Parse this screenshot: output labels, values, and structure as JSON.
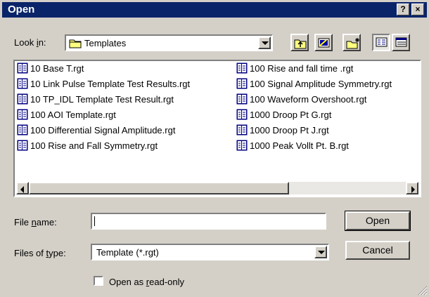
{
  "window": {
    "title": "Open",
    "help_glyph": "?",
    "close_glyph": "×"
  },
  "look_in": {
    "label_pre": "Look ",
    "label_key": "i",
    "label_post": "n:",
    "value": "Templates",
    "icon": "folder-icon"
  },
  "toolbar": {
    "buttons": [
      "up-one-level-icon",
      "create-new-folder-icon",
      "desktop-icon",
      "list-view-icon",
      "details-view-icon"
    ]
  },
  "files": {
    "col1": [
      "10 Base T.rgt",
      "10 Link Pulse Template Test Results.rgt",
      "10 TP_IDL Template Test Result.rgt",
      "100  AOI Template.rgt",
      "100 Differential Signal Amplitude.rgt",
      "100 Rise and Fall Symmetry.rgt"
    ],
    "col2": [
      "100 Rise and fall time .rgt",
      "100 Signal Amplitude Symmetry.rgt",
      "100 Waveform Overshoot.rgt",
      "1000 Droop Pt G.rgt",
      "1000 Droop Pt J.rgt",
      "1000 Peak Vollt Pt. B.rgt"
    ]
  },
  "file_name": {
    "label_pre": "File ",
    "label_key": "n",
    "label_post": "ame:",
    "value": ""
  },
  "file_type": {
    "label_pre": "Files of ",
    "label_key": "t",
    "label_post": "ype:",
    "value": "Template (*.rgt)"
  },
  "buttons": {
    "open": "Open",
    "cancel": "Cancel"
  },
  "read_only": {
    "label_pre": "Open as ",
    "label_key": "r",
    "label_post": "ead-only",
    "checked": false
  },
  "colors": {
    "titlebar": "#0a246a",
    "face": "#d4d0c8",
    "folder": "#ffff80"
  }
}
